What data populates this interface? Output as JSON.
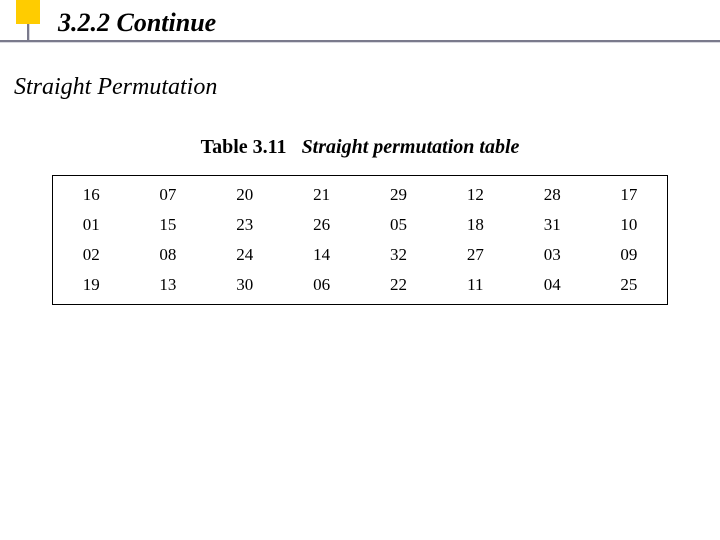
{
  "header": {
    "section_number": "3.2.2  Continue"
  },
  "subheading": "Straight Permutation",
  "caption": {
    "label": "Table 3.11",
    "title": "Straight permutation table"
  },
  "chart_data": {
    "type": "table",
    "title": "Table 3.11 Straight permutation table",
    "columns": 8,
    "rows": [
      [
        "16",
        "07",
        "20",
        "21",
        "29",
        "12",
        "28",
        "17"
      ],
      [
        "01",
        "15",
        "23",
        "26",
        "05",
        "18",
        "31",
        "10"
      ],
      [
        "02",
        "08",
        "24",
        "14",
        "32",
        "27",
        "03",
        "09"
      ],
      [
        "19",
        "13",
        "30",
        "06",
        "22",
        "11",
        "04",
        "25"
      ]
    ]
  }
}
